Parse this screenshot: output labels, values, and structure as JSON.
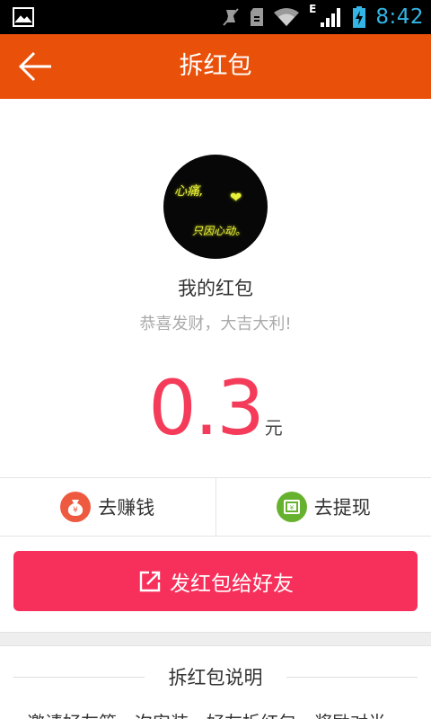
{
  "status_bar": {
    "time": "8:42",
    "network_type": "E",
    "icons": [
      "gallery-icon",
      "mute-icon",
      "sd-card-icon",
      "wifi-icon",
      "signal-icon",
      "battery-charging-icon"
    ]
  },
  "header": {
    "title": "拆红包",
    "back_icon": "arrow-left-icon",
    "bg_color": "#e9510b"
  },
  "profile": {
    "avatar_texts": [
      "心痛,",
      "❤",
      "只因心动。"
    ],
    "title": "我的红包",
    "subtitle": "恭喜发财，大吉大利!"
  },
  "amount": {
    "value": "0.3",
    "unit": "元",
    "color": "#f53b5a"
  },
  "actions": [
    {
      "label": "去赚钱",
      "icon": "money-bag-icon",
      "color": "#ee5a3f"
    },
    {
      "label": "去提现",
      "icon": "withdraw-icon",
      "color": "#66b22f"
    }
  ],
  "send_button": {
    "label": "发红包给好友",
    "icon": "share-icon",
    "color": "#f7305b"
  },
  "explain": {
    "title": "拆红包说明",
    "text_partial": "邀请好友第一次安装，好友拆红包，奖励对半"
  }
}
